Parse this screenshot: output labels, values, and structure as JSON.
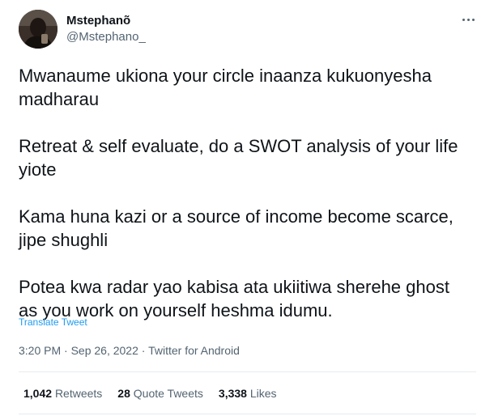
{
  "author": {
    "name": "Mstephanõ",
    "handle": "@Mstephano_"
  },
  "tweet": {
    "paragraphs": [
      "Mwanaume ukiona your circle inaanza kukuonyesha\nmadharau",
      "Retreat & self evaluate, do a SWOT analysis of your life\nyiote",
      "Kama huna kazi or a source of income become scarce,\njipe shughli",
      "Potea kwa radar yao kabisa ata ukiitiwa sherehe ghost\nas you work on yourself heshma idumu."
    ],
    "translate_label": "Translate Tweet",
    "timestamp": "3:20 PM · Sep 26, 2022 · ",
    "source": "Twitter for Android"
  },
  "stats": {
    "retweets": {
      "count": "1,042",
      "label": "Retweets"
    },
    "quotes": {
      "count": "28",
      "label": "Quote Tweets"
    },
    "likes": {
      "count": "3,338",
      "label": "Likes"
    }
  },
  "icons": {
    "more": "more-horizontal-icon",
    "avatar": "profile-photo"
  },
  "colors": {
    "text": "#0f1419",
    "muted": "#536471",
    "link": "#1d9bf0",
    "divider": "#e6ecf0"
  }
}
